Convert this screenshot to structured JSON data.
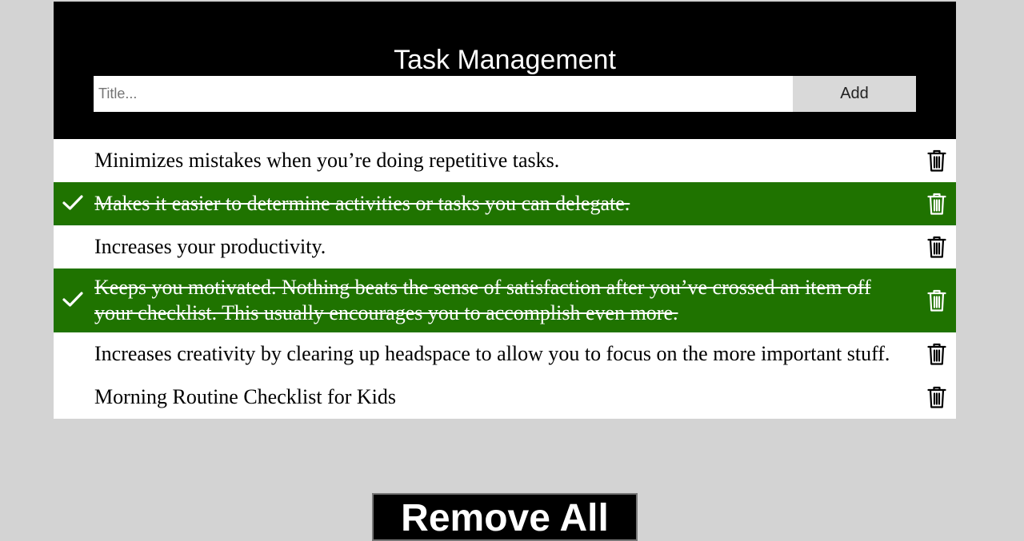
{
  "header": {
    "title": "Task Management"
  },
  "form": {
    "title_placeholder": "Title...",
    "title_value": "",
    "add_label": "Add"
  },
  "tasks": [
    {
      "text": "Minimizes mistakes when you’re doing repetitive tasks.",
      "checked": false
    },
    {
      "text": "Makes it easier to determine activities or tasks you can delegate.",
      "checked": true
    },
    {
      "text": "Increases your productivity.",
      "checked": false
    },
    {
      "text": "Keeps you motivated. Nothing beats the sense of satisfaction after you’ve crossed an item off your checklist. This usually encourages you to accomplish even more.",
      "checked": true
    },
    {
      "text": "Increases creativity by clearing up headspace to allow you to focus on the more important stuff.",
      "checked": false
    },
    {
      "text": "Morning Routine Checklist for Kids",
      "checked": false
    }
  ],
  "footer": {
    "remove_all_label": "Remove All"
  },
  "colors": {
    "page_background": "#d3d3d3",
    "header_background": "#000000",
    "checked_background": "#1f7300",
    "add_button_background": "#d9d9d9"
  },
  "icons": {
    "check": "check-icon",
    "delete": "trash-icon"
  }
}
